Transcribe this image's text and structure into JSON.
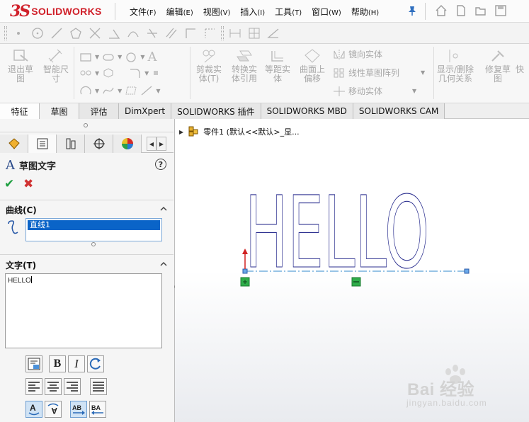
{
  "app": {
    "logo_mark": "3S",
    "logo_text": "SOLIDWORKS"
  },
  "menu": [
    {
      "label": "文件",
      "acc": "(F)"
    },
    {
      "label": "编辑",
      "acc": "(E)"
    },
    {
      "label": "视图",
      "acc": "(V)"
    },
    {
      "label": "插入",
      "acc": "(I)"
    },
    {
      "label": "工具",
      "acc": "(T)"
    },
    {
      "label": "窗口",
      "acc": "(W)"
    },
    {
      "label": "帮助",
      "acc": "(H)"
    }
  ],
  "commands": {
    "exit_sketch": "退出草图",
    "smart_dim": "智能尺寸",
    "trim": "剪裁实体(T)",
    "convert": "转换实体引用",
    "offset": "等距实体",
    "surface_offset": "曲面上偏移",
    "mirror": "镜向实体",
    "linear_pattern": "线性草图阵列",
    "move": "移动实体",
    "display_delete": "显示/删除几何关系",
    "repair": "修复草图",
    "quick": "快"
  },
  "tabs": [
    {
      "label": "特征",
      "state": "active"
    },
    {
      "label": "草图",
      "state": "plain"
    },
    {
      "label": "评估",
      "state": "plain"
    },
    {
      "label": "DimXpert",
      "state": "plain"
    },
    {
      "label": "SOLIDWORKS 插件",
      "state": "plain"
    },
    {
      "label": "SOLIDWORKS MBD",
      "state": "plain"
    },
    {
      "label": "SOLIDWORKS CAM",
      "state": "plain"
    }
  ],
  "property_manager": {
    "title": "草图文字",
    "help": "?",
    "ok": "✔",
    "cancel": "✖",
    "curves_group": "曲线(C)",
    "curve_selected": "直线1",
    "text_group": "文字(T)",
    "text_value": "HELLO"
  },
  "format_buttons": {
    "bold": "B",
    "italic": "I"
  },
  "tree": {
    "node": "零件1  (默认<<默认>_显..."
  },
  "sketch": {
    "text": "HELLO"
  },
  "watermark": {
    "text": "Bai 经验",
    "sub": "jingyan.baidu.com"
  },
  "colors": {
    "brand_red": "#d0202a",
    "selection_blue": "#0a64c8",
    "sketch_blue": "#2b2f8f",
    "ok_green": "#21a042",
    "cancel_red": "#d03232"
  }
}
